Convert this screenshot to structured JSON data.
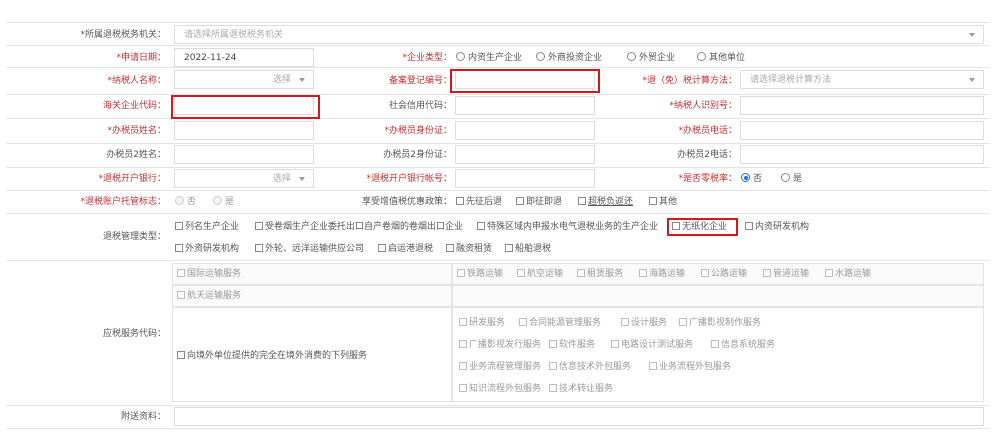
{
  "form": {
    "tax_authority": {
      "label": "*所属退税税务机关：",
      "placeholder": "请选择所属退税税务机关"
    },
    "apply_date": {
      "label": "*申请日期：",
      "value": "2022-11-24"
    },
    "enterprise_type": {
      "label": "*企业类型：",
      "options": [
        "内资生产企业",
        "外商投资企业",
        "外贸企业",
        "其他单位"
      ]
    },
    "taxpayer_name": {
      "label": "*纳税人名称：",
      "select_label": "选择"
    },
    "filing_no": {
      "label": "备案登记编号："
    },
    "refund_method": {
      "label": "*退（免）税计算方法：",
      "placeholder": "请选择退税计算方法"
    },
    "customs_code": {
      "label": "海关企业代码："
    },
    "credit_code": {
      "label": "社会信用代码："
    },
    "taxpayer_id": {
      "label": "*纳税人识别号："
    },
    "agent_name": {
      "label": "*办税员姓名："
    },
    "agent_id": {
      "label": "*办税员身份证："
    },
    "agent_phone": {
      "label": "*办税员电话："
    },
    "agent2_name": {
      "label": "办税员2姓名："
    },
    "agent2_id": {
      "label": "办税员2身份证："
    },
    "agent2_phone": {
      "label": "办税员2电话："
    },
    "bank": {
      "label": "*退税开户银行：",
      "select_label": "选择"
    },
    "bank_account": {
      "label": "*退税开户银行帐号："
    },
    "zero_rate": {
      "label": "*是否零税率：",
      "options": [
        "否",
        "是"
      ]
    },
    "custody": {
      "label": "*退税账户托管标志：",
      "options": [
        "否",
        "是"
      ]
    },
    "vat_policy": {
      "label": "享受增值税优惠政策：",
      "options": [
        "先征后退",
        "即征即退",
        "超税负返还",
        "其他"
      ]
    },
    "mgmt_type": {
      "label": "退税管理类型：",
      "row1": [
        "列名生产企业",
        "受卷烟生产企业委托出口自产卷烟的卷烟出口企业",
        "特殊区域内申报水电气退税业务的生产企业",
        "无纸化企业",
        "内资研发机构"
      ],
      "row2": [
        "外资研发机构",
        "外轮、远洋运输供应公司",
        "启运港退税",
        "融资租赁",
        "船舶退税"
      ]
    },
    "service_code": {
      "label": "应税服务代码：",
      "intl_transport": "国际运输服务",
      "transport_items": [
        "铁路运输",
        "航空运输",
        "租赁服务",
        "海路运输",
        "公路运输",
        "管道运输",
        "水路运输"
      ],
      "space_transport": "航天运输服务",
      "overseas": "向境外单位提供的完全在境外消费的下列服务",
      "overseas_row1": [
        "研发服务",
        "合同能源管理服务",
        "设计服务",
        "广播影视制作服务"
      ],
      "overseas_row2": [
        "广播影视发行服务",
        "软件服务",
        "电路设计测试服务",
        "信息系统服务"
      ],
      "overseas_row3": [
        "业务流程管理服务",
        "信息技术外包服务",
        "业务流程外包服务"
      ],
      "overseas_row4": [
        "知识流程外包服务",
        "技术转让服务"
      ]
    },
    "attachment": {
      "label": "附送资料："
    }
  },
  "icons": {
    "dropdown": "chevron-down-icon",
    "checkbox": "checkbox-icon",
    "radio": "radio-icon"
  },
  "colors": {
    "required": "#e02020",
    "highlight": "#d9161b",
    "accent": "#1e6fd9"
  }
}
